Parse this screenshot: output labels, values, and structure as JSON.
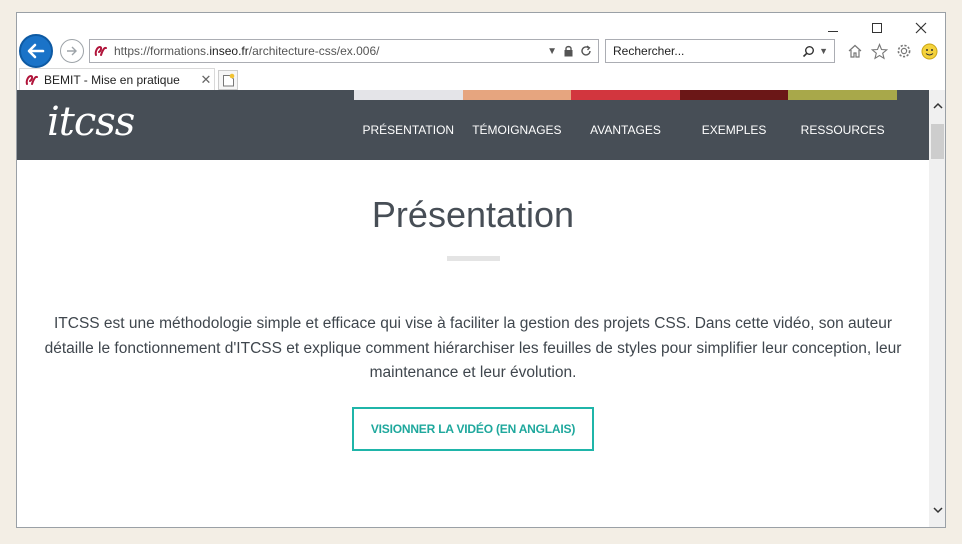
{
  "browser": {
    "address": {
      "prefix": "https://formations.",
      "domain": "inseo.fr",
      "path": "/architecture-css/ex.006/"
    },
    "search_placeholder": "Rechercher...",
    "tab_title": "BEMIT - Mise en pratique"
  },
  "site": {
    "logo": "itcss",
    "strip_colors": [
      "#e4e4e8",
      "#e6a57f",
      "#d2363e",
      "#6b1717",
      "#a8a84a"
    ],
    "nav": [
      "PRÉSENTATION",
      "TÉMOIGNAGES",
      "AVANTAGES",
      "EXEMPLES",
      "RESSOURCES"
    ]
  },
  "main": {
    "title": "Présentation",
    "intro": "ITCSS est une méthodologie simple et efficace qui vise à faciliter la gestion des projets CSS. Dans cette vidéo, son auteur détaille le fonctionnement d'ITCSS et explique comment hiérarchiser les feuilles de styles pour simplifier leur conception, leur maintenance et leur évolution.",
    "cta": "VISIONNER LA VIDÉO (EN ANGLAIS)"
  },
  "colors": {
    "header_bg": "#474e56",
    "accent": "#1fb5a9"
  }
}
